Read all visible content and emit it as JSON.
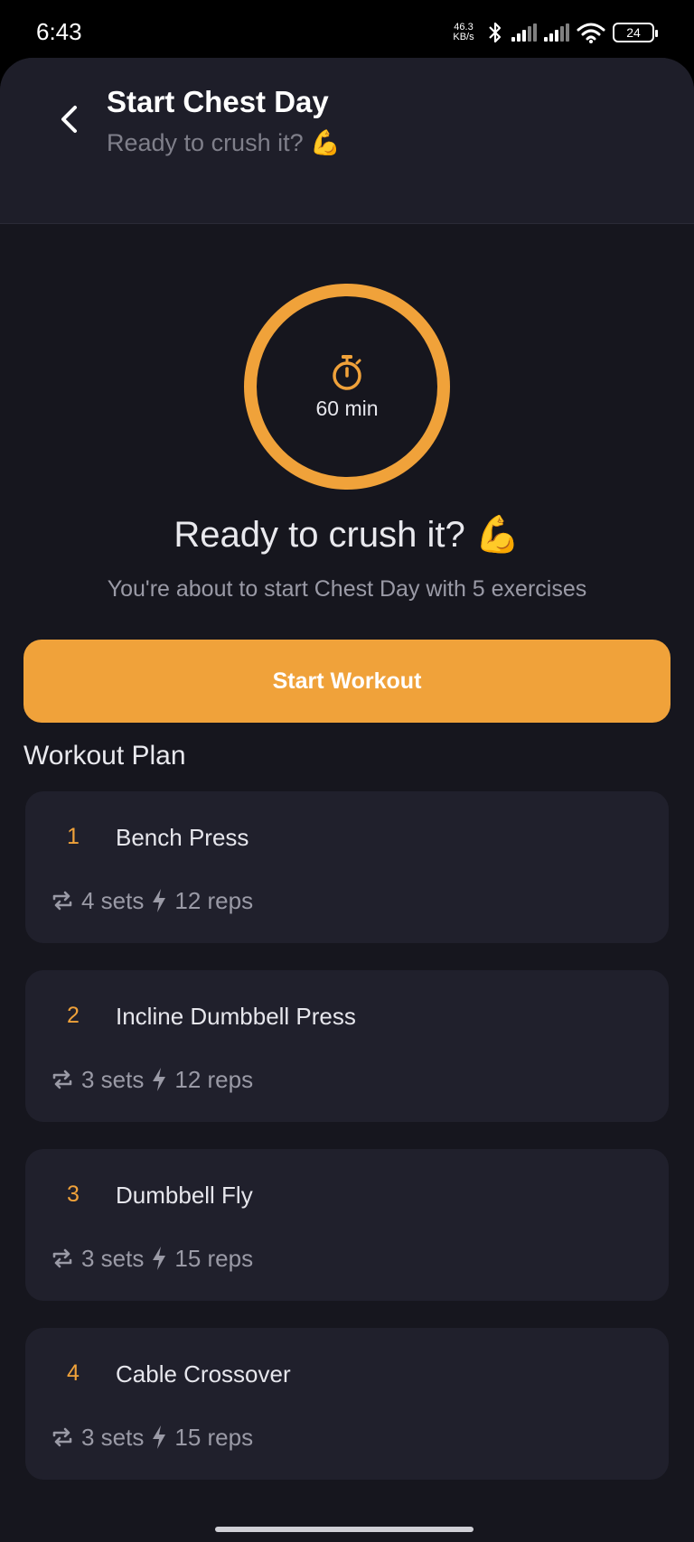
{
  "status_bar": {
    "time": "6:43",
    "net_speed_value": "46.3",
    "net_speed_unit": "KB/s",
    "battery": "24"
  },
  "header": {
    "title": "Start Chest Day",
    "subtitle": "Ready to crush it? 💪"
  },
  "timer": {
    "label": "60 min"
  },
  "hero": {
    "headline": "Ready to crush it? 💪",
    "description": "You're about to start Chest Day with 5 exercises"
  },
  "start_button": {
    "label": "Start Workout"
  },
  "plan": {
    "title": "Workout Plan",
    "exercises": [
      {
        "number": "1",
        "name": "Bench Press",
        "sets": "4 sets",
        "reps": "12 reps"
      },
      {
        "number": "2",
        "name": "Incline Dumbbell Press",
        "sets": "3 sets",
        "reps": "12 reps"
      },
      {
        "number": "3",
        "name": "Dumbbell Fly",
        "sets": "3 sets",
        "reps": "15 reps"
      },
      {
        "number": "4",
        "name": "Cable Crossover",
        "sets": "3 sets",
        "reps": "15 reps"
      }
    ]
  },
  "colors": {
    "accent": "#f0a23a",
    "background": "#16161e",
    "card": "#20202c",
    "header": "#1e1e29"
  },
  "icons": [
    "back-arrow-icon",
    "stopwatch-icon",
    "repeat-icon",
    "lightning-icon",
    "bluetooth-icon",
    "wifi-icon",
    "signal-icon",
    "battery-icon"
  ]
}
